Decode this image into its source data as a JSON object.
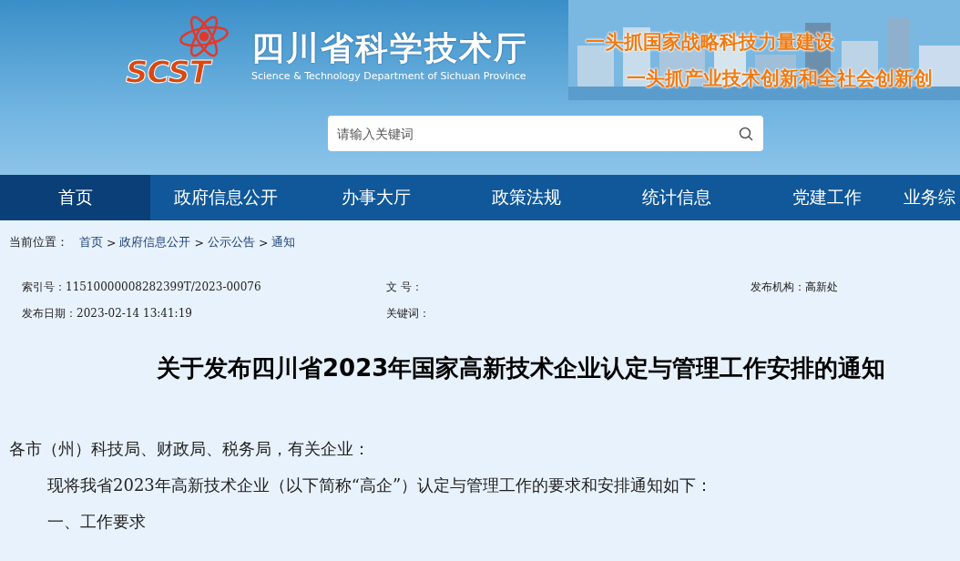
{
  "header": {
    "logo_text": "SCST",
    "site_title": "四川省科学技术厅",
    "site_subtitle": "Science & Technology Department of Sichuan Province",
    "slogans": [
      "一头抓国家战略科技力量建设",
      "一头抓产业技术创新和全社会创新创"
    ],
    "search": {
      "placeholder": "请输入关键词"
    }
  },
  "nav": [
    {
      "label": "首页",
      "selected": true
    },
    {
      "label": "政府信息公开",
      "selected": false
    },
    {
      "label": "办事大厅",
      "selected": false
    },
    {
      "label": "政策法规",
      "selected": false
    },
    {
      "label": "统计信息",
      "selected": false
    },
    {
      "label": "党建工作",
      "selected": false
    },
    {
      "label": "业务综",
      "selected": false
    }
  ],
  "breadcrumb": {
    "label": "当前位置：",
    "items": [
      "首页",
      "政府信息公开",
      "公示公告",
      "通知"
    ],
    "separator": ">"
  },
  "meta": [
    [
      "索引号：11510000008282399T/2023-00076",
      "文 号：",
      "发布机构：高新处"
    ],
    [
      "发布日期：2023-02-14 13:41:19",
      "关键词："
    ]
  ],
  "article": {
    "title": "关于发布四川省2023年国家高新技术企业认定与管理工作安排的通知",
    "paragraphs": [
      {
        "kind": "salutation",
        "text": "各市（州）科技局、财政局、税务局，有关企业："
      },
      {
        "kind": "indented",
        "text": "现将我省2023年高新技术企业（以下简称“高企”）认定与管理工作的要求和安排通知如下："
      },
      {
        "kind": "indented",
        "text": "一、工作要求"
      }
    ]
  }
}
